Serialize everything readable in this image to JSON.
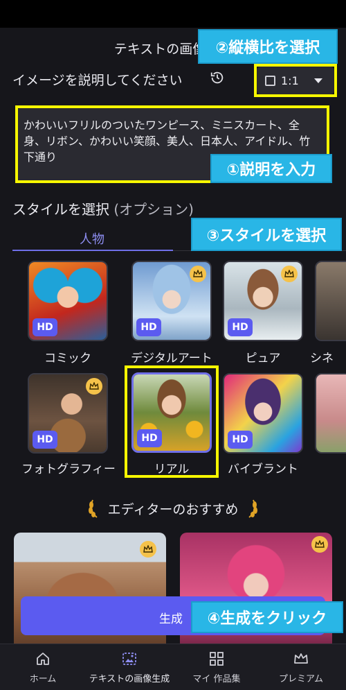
{
  "header": {
    "title": "テキストの画像生成"
  },
  "annotations": {
    "ratio": "②縦横比を選択",
    "prompt": "①説明を入力",
    "style": "③スタイルを選択",
    "generate": "④生成をクリック"
  },
  "prompt": {
    "label": "イメージを説明してください",
    "text": "かわいいフリルのついたワンピース、ミニスカート、全身、リボン、かわいい笑顔、美人、日本人、アイドル、竹下通り"
  },
  "ratio": {
    "value": "1:1"
  },
  "styles": {
    "heading": "スタイルを選択",
    "heading_option": "(オプション)",
    "tab": "人物",
    "hd_badge": "HD",
    "items": [
      {
        "label": "コミック",
        "crown": false
      },
      {
        "label": "デジタルアート",
        "crown": true
      },
      {
        "label": "ピュア",
        "crown": true
      },
      {
        "label": "シネ",
        "crown": false
      },
      {
        "label": "フォトグラフィー",
        "crown": true
      },
      {
        "label": "リアル",
        "crown": false,
        "selected": true
      },
      {
        "label": "バイブラント",
        "crown": false
      }
    ]
  },
  "recommend": {
    "heading": "エディターのおすすめ"
  },
  "generate": {
    "label": "生成"
  },
  "nav": {
    "items": [
      {
        "label": "ホーム",
        "icon": "home-icon"
      },
      {
        "label": "テキストの画像生成",
        "icon": "text-to-image-icon"
      },
      {
        "label": "マイ 作品集",
        "icon": "grid-icon"
      },
      {
        "label": "プレミアム",
        "icon": "crown-icon"
      }
    ]
  },
  "colors": {
    "accent": "#5b5bf0",
    "highlight": "#f7f700",
    "annotation": "#29b6e6",
    "background": "#16161b"
  }
}
